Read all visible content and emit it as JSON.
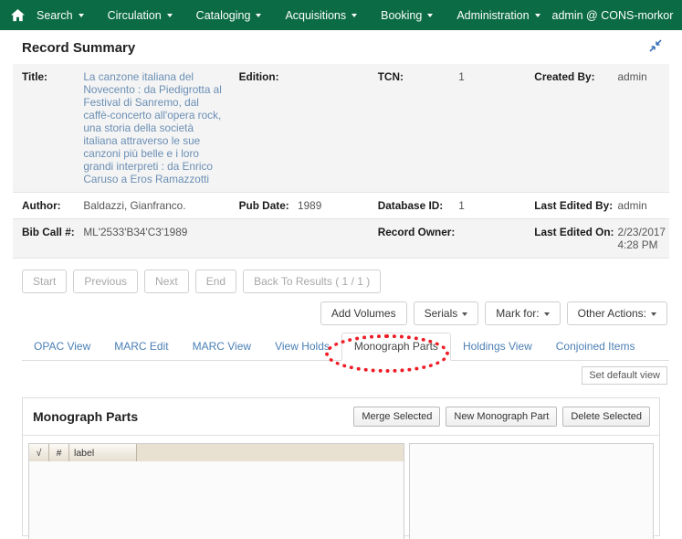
{
  "navbar": {
    "home_icon": "home-icon",
    "menu_icon": "grid-menu-icon",
    "items": [
      {
        "label": "Search",
        "caret": true
      },
      {
        "label": "Circulation",
        "caret": true
      },
      {
        "label": "Cataloging",
        "caret": true
      },
      {
        "label": "Acquisitions",
        "caret": true
      },
      {
        "label": "Booking",
        "caret": true
      },
      {
        "label": "Administration",
        "caret": true
      }
    ],
    "user": "admin @ CONS-morkor",
    "background": "#0a6b44"
  },
  "summary": {
    "heading": "Record Summary",
    "collapse_icon": "collapse-diagonal-icon",
    "rows": [
      {
        "cells": [
          {
            "label": "Title:",
            "value": "La canzone italiana del Novecento : da Piedigrotta al Festival di Sanremo, dal caffè-concerto all'opera rock, una storia della società italiana attraverso le sue canzoni più belle e i loro grandi interpreti : da Enrico Caruso a Eros Ramazzotti",
            "link": true
          },
          {
            "label": "Edition:",
            "value": ""
          },
          {
            "label": "TCN:",
            "value": "1"
          },
          {
            "label": "Created By:",
            "value": "admin"
          }
        ]
      },
      {
        "cells": [
          {
            "label": "Author:",
            "value": "Baldazzi, Gianfranco."
          },
          {
            "label": "Pub Date:",
            "value": "1989"
          },
          {
            "label": "Database ID:",
            "value": "1"
          },
          {
            "label": "Last Edited By:",
            "value": "admin"
          }
        ]
      },
      {
        "cells": [
          {
            "label": "Bib Call #:",
            "value": "ML'2533'B34'C3'1989"
          },
          {
            "label": "",
            "value": ""
          },
          {
            "label": "Record Owner:",
            "value": ""
          },
          {
            "label": "Last Edited On:",
            "value": "2/23/2017 4:28 PM"
          }
        ]
      }
    ]
  },
  "nav_buttons": [
    {
      "label": "Start",
      "disabled": true
    },
    {
      "label": "Previous",
      "disabled": true
    },
    {
      "label": "Next",
      "disabled": true
    },
    {
      "label": "End",
      "disabled": true
    },
    {
      "label": "Back To Results ( 1 / 1 )",
      "disabled": true
    }
  ],
  "action_buttons": [
    {
      "label": "Add Volumes",
      "caret": false
    },
    {
      "label": "Serials:",
      "display": "Serials",
      "caret": true
    },
    {
      "label": "Mark for:",
      "display": "Mark for:",
      "caret": true
    },
    {
      "label": "Other Actions:",
      "display": "Other Actions:",
      "caret": true
    }
  ],
  "tabs": [
    {
      "label": "OPAC View",
      "active": false
    },
    {
      "label": "MARC Edit",
      "active": false
    },
    {
      "label": "MARC View",
      "active": false
    },
    {
      "label": "View Holds",
      "active": false
    },
    {
      "label": "Monograph Parts",
      "active": true,
      "highlighted": true
    },
    {
      "label": "Holdings View",
      "active": false
    },
    {
      "label": "Conjoined Items",
      "active": false
    }
  ],
  "set_default_view": "Set default view",
  "monograph_parts": {
    "title": "Monograph Parts",
    "buttons": [
      {
        "label": "Merge Selected"
      },
      {
        "label": "New Monograph Part"
      },
      {
        "label": "Delete Selected"
      }
    ],
    "grid": {
      "columns": [
        {
          "label": "√",
          "name": "checkbox-column"
        },
        {
          "label": "#",
          "name": "number-column"
        },
        {
          "label": "label",
          "name": "label-column"
        }
      ],
      "rows": []
    }
  },
  "annotation": {
    "color": "#ee1c25",
    "target": "Monograph Parts"
  }
}
